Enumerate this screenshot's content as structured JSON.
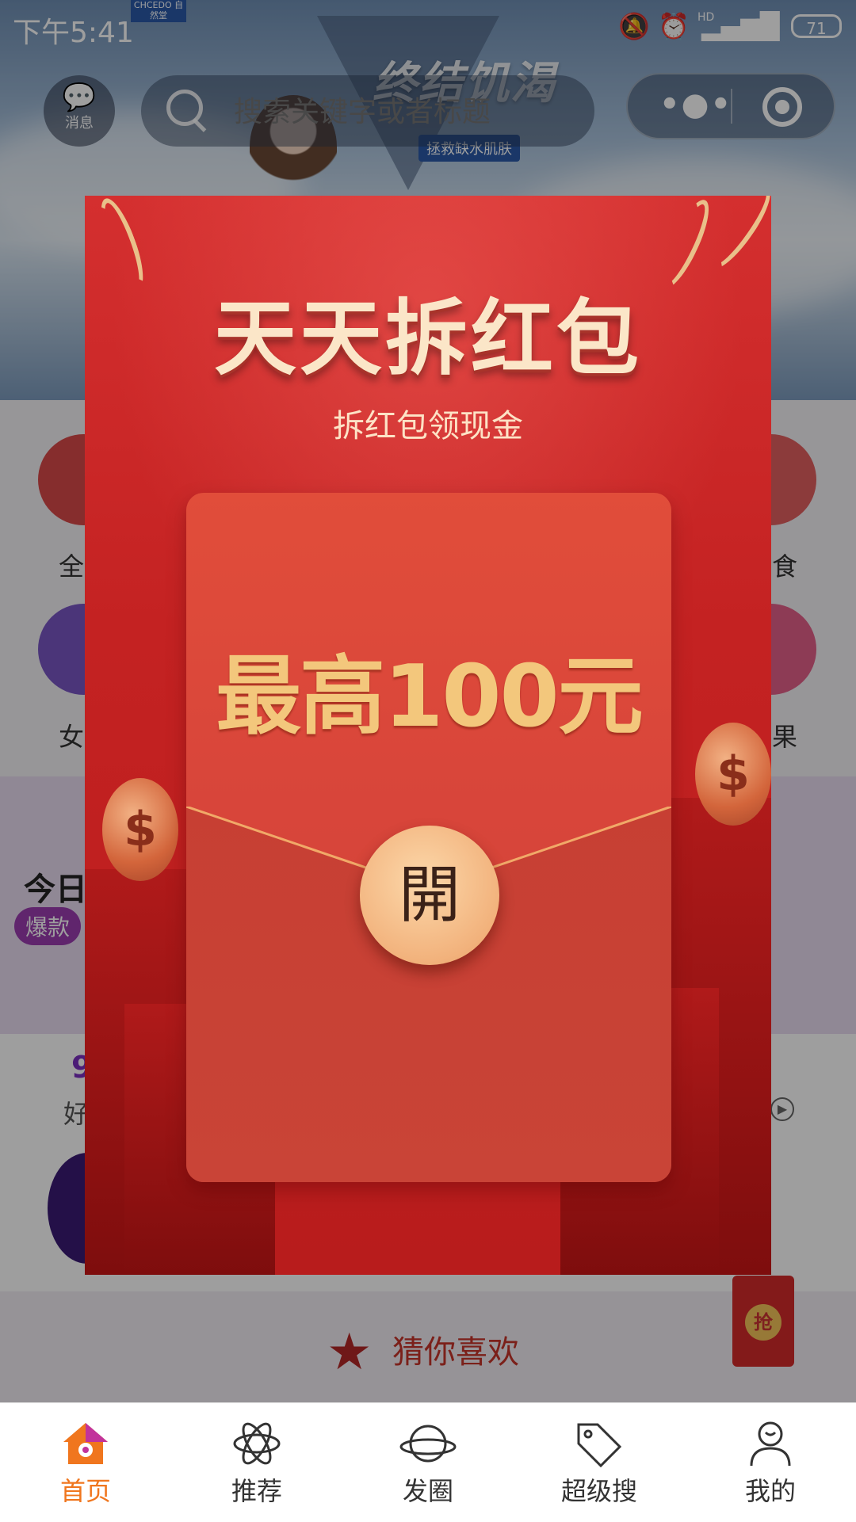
{
  "status_bar": {
    "time": "下午5:41",
    "battery": "71",
    "network": "HD"
  },
  "banner": {
    "brand": "CHCEDO\n自然堂",
    "headline": "终结饥渴",
    "subline": "拯救缺水肌肤"
  },
  "header": {
    "message_label": "消息",
    "search_placeholder": "搜索关键字或者标题"
  },
  "categories": [
    {
      "label": "全"
    },
    {
      "label": "食"
    },
    {
      "label": "女"
    },
    {
      "label": "果"
    }
  ],
  "promo": {
    "title": "今日",
    "tag": "爆款"
  },
  "section": {
    "num": "9",
    "sub": "好"
  },
  "guess": {
    "label": "猜你喜欢"
  },
  "floating_envelope": {
    "label": "抢"
  },
  "modal": {
    "title": "天天拆红包",
    "subtitle": "拆红包领现金",
    "amount": "最高100元",
    "open_label": "開"
  },
  "tabbar": {
    "items": [
      {
        "label": "首页",
        "icon": "home-icon",
        "active": true
      },
      {
        "label": "推荐",
        "icon": "atom-icon"
      },
      {
        "label": "发圈",
        "icon": "planet-icon"
      },
      {
        "label": "超级搜",
        "icon": "tag-icon"
      },
      {
        "label": "我的",
        "icon": "user-icon"
      }
    ]
  },
  "colors": {
    "accent": "#f0761e",
    "modal_red": "#c42222",
    "gold": "#f3c77c"
  }
}
